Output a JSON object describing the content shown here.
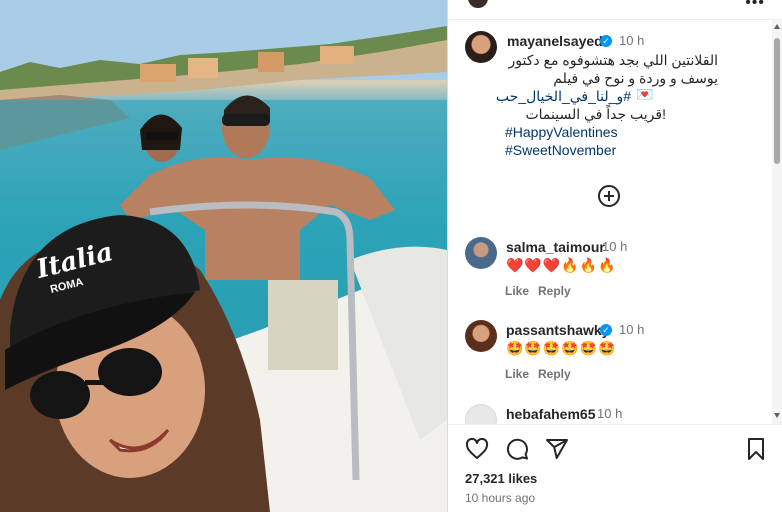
{
  "post": {
    "author": "mayanelsayed",
    "time": "10 h",
    "caption_line1": "القلانتين اللي بجد هتشوفوه مع دكتور",
    "caption_line2": "يوسف و وردة و نوح في فيلم",
    "caption_tag_arabic": "#و_لنا_في_الخيال_حب",
    "caption_line4": "!قريب جداً في السينمات",
    "hashtag1": "#HappyValentines",
    "hashtag2": "#SweetNovember",
    "load_more_icon": "plus-circle-icon",
    "cap_text": "Italia",
    "cap_subtext": "ROMA"
  },
  "comments": [
    {
      "user": "salma_taimour",
      "time": "10 h",
      "verified": false,
      "text": "❤️❤️❤️🔥🔥🔥",
      "like": "Like",
      "reply": "Reply"
    },
    {
      "user": "passantshawky",
      "time": "10 h",
      "verified": true,
      "text": "🤩🤩🤩🤩🤩🤩",
      "like": "Like",
      "reply": "Reply"
    },
    {
      "user": "hebafahem65",
      "time": "10 h",
      "verified": false
    }
  ],
  "footer": {
    "likes": "27,321 likes",
    "posted": "10 hours ago",
    "icons": [
      "heart-icon",
      "comment-icon",
      "share-icon",
      "bookmark-icon"
    ]
  },
  "colors": {
    "accent": "#0095f6",
    "hashtag": "#00376b",
    "meta": "#737373"
  }
}
